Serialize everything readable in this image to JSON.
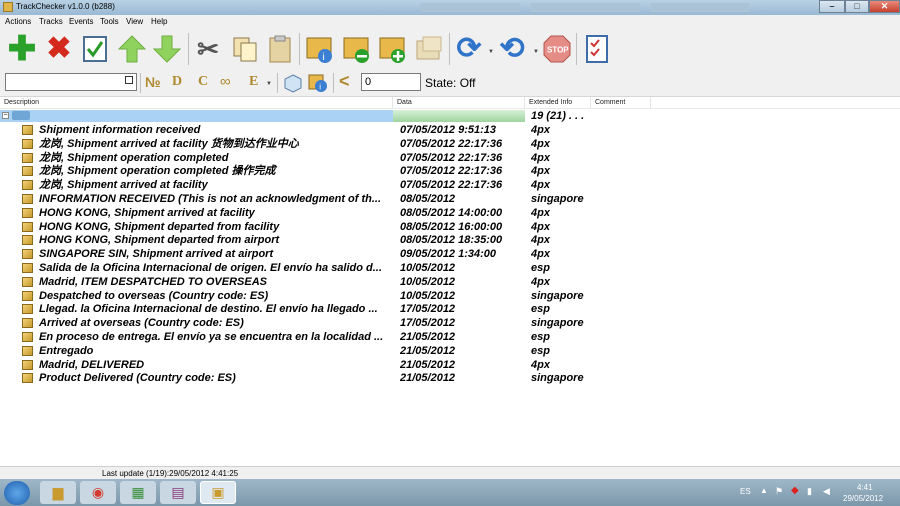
{
  "window": {
    "title": "TrackChecker v1.0.0   (b288)",
    "controls": {
      "minimize": "–",
      "maximize": "□",
      "close": "✕"
    }
  },
  "menu": [
    "Actions",
    "Tracks",
    "Events",
    "Tools",
    "View",
    "Help"
  ],
  "toolbar": {
    "state_label": "State: Off",
    "number_value": "0",
    "search_value": "",
    "format_buttons": [
      "№",
      "D",
      "C",
      "E"
    ]
  },
  "columns": {
    "description": "Description",
    "date": "Data",
    "extended": "Extended Info",
    "comment": "Comment"
  },
  "group": {
    "summary": "19 (21) . . ."
  },
  "rows": [
    {
      "desc": "Shipment information received",
      "date": "07/05/2012 9:51:13",
      "info": "4px"
    },
    {
      "desc": "龙岗, Shipment arrived at facility 货物到达作业中心",
      "date": "07/05/2012 22:17:36",
      "info": "4px"
    },
    {
      "desc": "龙岗, Shipment operation completed",
      "date": "07/05/2012 22:17:36",
      "info": "4px"
    },
    {
      "desc": "龙岗, Shipment operation completed 操作完成",
      "date": "07/05/2012 22:17:36",
      "info": "4px"
    },
    {
      "desc": "龙岗, Shipment arrived at facility",
      "date": "07/05/2012 22:17:36",
      "info": "4px"
    },
    {
      "desc": "INFORMATION RECEIVED (This is not an acknowledgment of th...",
      "date": "08/05/2012",
      "info": "singapore"
    },
    {
      "desc": "HONG KONG, Shipment arrived at facility",
      "date": "08/05/2012 14:00:00",
      "info": "4px"
    },
    {
      "desc": "HONG KONG, Shipment departed from facility",
      "date": "08/05/2012 16:00:00",
      "info": "4px"
    },
    {
      "desc": "HONG KONG, Shipment departed from airport",
      "date": "08/05/2012 18:35:00",
      "info": "4px"
    },
    {
      "desc": "SINGAPORE SIN, Shipment arrived at airport",
      "date": "09/05/2012 1:34:00",
      "info": "4px"
    },
    {
      "desc": "Salida de la Oficina Internacional de origen. El envío ha salido d...",
      "date": "10/05/2012",
      "info": "esp"
    },
    {
      "desc": "Madrid, ITEM DESPATCHED TO OVERSEAS",
      "date": "10/05/2012",
      "info": "4px"
    },
    {
      "desc": "Despatched to overseas (Country code: ES)",
      "date": "10/05/2012",
      "info": "singapore"
    },
    {
      "desc": "Llegad. la Oficina Internacional de destino. El envío ha llegado ...",
      "date": "17/05/2012",
      "info": "esp"
    },
    {
      "desc": "Arrived at overseas (Country code: ES)",
      "date": "17/05/2012",
      "info": "singapore"
    },
    {
      "desc": "En proceso de entrega. El envío ya se encuentra en la localidad ...",
      "date": "21/05/2012",
      "info": "esp"
    },
    {
      "desc": "Entregado",
      "date": "21/05/2012",
      "info": "esp"
    },
    {
      "desc": "Madrid, DELIVERED",
      "date": "21/05/2012",
      "info": "4px"
    },
    {
      "desc": "Product Delivered (Country code: ES)",
      "date": "21/05/2012",
      "info": "singapore"
    }
  ],
  "status": {
    "text": "Last update (1/19):29/05/2012 4:41:25"
  },
  "taskbar": {
    "lang": "ES",
    "time": "4:41",
    "date": "29/05/2012",
    "apps": [
      "explorer-icon",
      "chrome-icon",
      "network-app-icon",
      "winrar-icon",
      "trackchecker-icon"
    ]
  }
}
